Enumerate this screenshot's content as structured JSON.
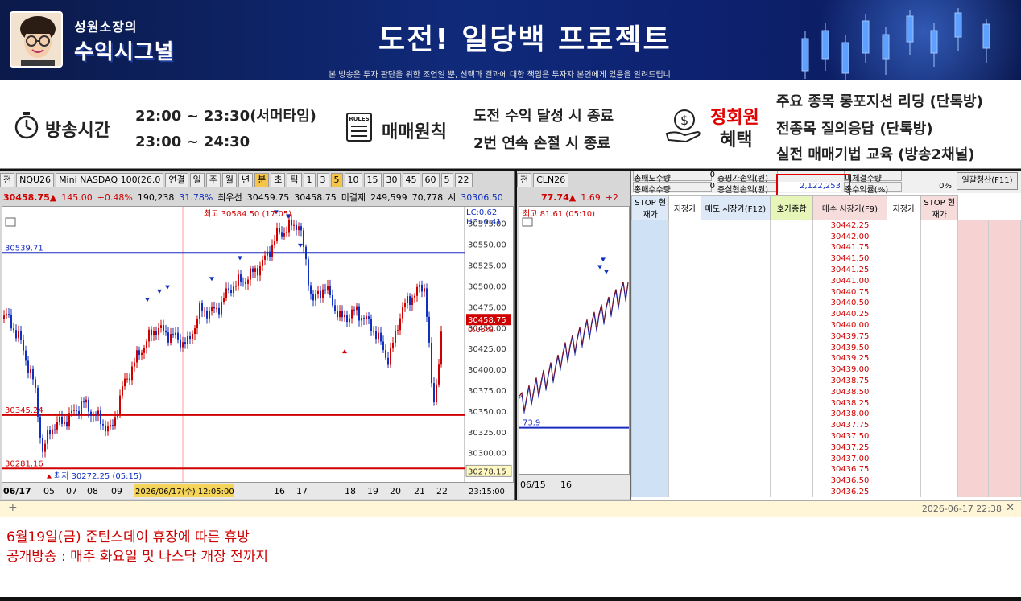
{
  "banner": {
    "brand_line1": "성원소장의",
    "brand_line2": "수익시그널",
    "title": "도전! 일당백 프로젝트",
    "disclaimer": "본 방송은 투자 판단을 위한 조언일 뿐, 선택과 결과에 대한 책임은 투자자 본인에게 있음을 알려드립니"
  },
  "info": {
    "broadcast_label": "방송시간",
    "time1": "22:00 ~ 23:30(서머타임)",
    "time2": "23:00 ~ 24:30",
    "rules_icon_text": "RULES",
    "rules_label": "매매원칙",
    "rule1": "도전 수익 달성 시 종료",
    "rule2": "2번 연속 손절 시 종료",
    "member_label1": "정회원",
    "member_label2": "혜택",
    "benefit1": "주요 종목 롱포지션 리딩 (단톡방)",
    "benefit2": "전종목 질의응답 (단톡방)",
    "benefit3": "실전 매매기법 교육 (방송2채널)"
  },
  "chart1": {
    "toolbar": [
      "전",
      "NQU26",
      "Mini NASDAQ 100(26.0",
      "연결",
      "일",
      "주",
      "월",
      "년",
      "분",
      "초",
      "틱",
      "1",
      "3",
      "5",
      "10",
      "15",
      "30",
      "45",
      "60",
      "5",
      "22"
    ],
    "price": "30458.75▲",
    "change": "145.00",
    "pct": "+0.48%",
    "vol": "190,238",
    "vol_pct": "31.78%",
    "prev_label": "최우선",
    "bid": "30459.75",
    "ask": "30458.75",
    "unfilled": "미결제",
    "oi": "249,599",
    "oi_chg": "70,778",
    "open_label": "시",
    "open": "30306.50",
    "high_label": "최고 30584.50 (17:05)",
    "low_label": "최저 30272.25 (05:15)",
    "lc": "LC:0.62",
    "hc": "HC:-0.41",
    "line_top": "30539.71",
    "line_mid": "30345.24",
    "line_low": "30281.16",
    "price_tag": "30458.75",
    "price_tag_pct": "0.05%",
    "low_tag": "30278.15",
    "y_ticks": [
      "30575.00",
      "30550.00",
      "30525.00",
      "30500.00",
      "30475.00",
      "30450.00",
      "30425.00",
      "30400.00",
      "30375.00",
      "30350.00",
      "30325.00",
      "30300.00"
    ],
    "x_date": "06/17",
    "x_ticks": [
      "05",
      "07",
      "08",
      "09",
      "16",
      "17",
      "18",
      "19",
      "20",
      "21",
      "22"
    ],
    "cursor_label": "2026/06/17(수) 12:05:00",
    "time_label": "23:15:00"
  },
  "chart2": {
    "toolbar": [
      "전",
      "CLN26"
    ],
    "price": "77.74▲",
    "change": "1.69",
    "pct": "+2",
    "high_label": "최고 81.61 (05:10)",
    "low_label": "73.9",
    "x_date": "06/15",
    "x_tick": "16"
  },
  "orderbook": {
    "top_rows": [
      [
        "총매도수량",
        "0",
        "총평가손익(원)",
        "",
        "미체결수량",
        "",
        "일괄청산(F11)"
      ],
      [
        "총매수수량",
        "0",
        "총실현손익(원)",
        "2,122,253",
        "총수익률(%)",
        "0%",
        ""
      ]
    ],
    "headers": [
      "STOP 현재가",
      "지정가",
      "매도 시장가(F12)",
      "호가종합",
      "매수 시장가(F9)",
      "지정가",
      "STOP 현재가"
    ],
    "prices": [
      "30442.25",
      "30442.00",
      "30441.75",
      "30441.50",
      "30441.25",
      "30441.00",
      "30440.75",
      "30440.50",
      "30440.25",
      "30440.00",
      "30439.75",
      "30439.50",
      "30439.25",
      "30439.00",
      "30438.75",
      "30438.50",
      "30438.25",
      "30438.00",
      "30437.75",
      "30437.50",
      "30437.25",
      "30437.00",
      "30436.75",
      "30436.50",
      "30436.25"
    ]
  },
  "notice": {
    "timestamp": "2026-06-17  22:38",
    "line1": "6월19일(금) 준틴스데이 휴장에 따른 휴방",
    "line2": "공개방송 : 매주 화요일 및 나스닥 개장 전까지"
  },
  "colors": {
    "up": "#d00000",
    "down": "#1030c0",
    "accent": "#e00000",
    "blue_line": "#1a2cc0"
  }
}
